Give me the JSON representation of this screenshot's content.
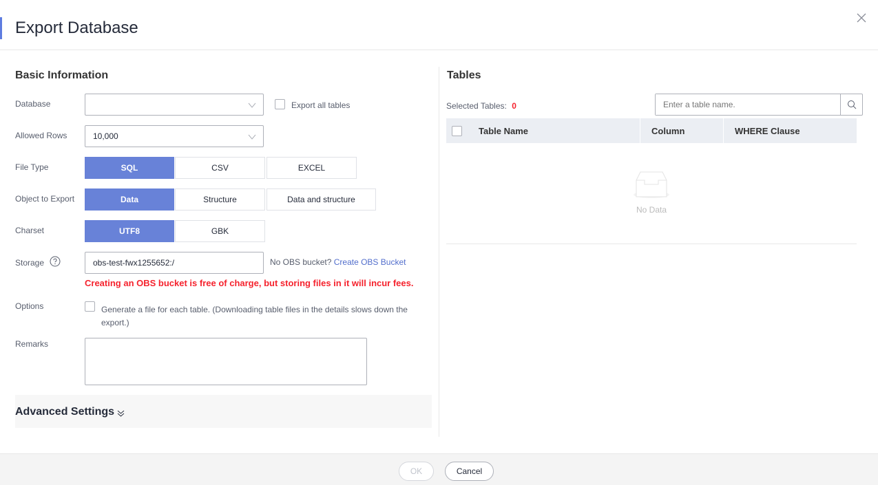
{
  "dialog": {
    "title": "Export Database"
  },
  "basic": {
    "heading": "Basic Information",
    "database": {
      "label": "Database",
      "value": "",
      "export_all": "Export all tables"
    },
    "allowed_rows": {
      "label": "Allowed Rows",
      "value": "10,000"
    },
    "file_type": {
      "label": "File Type",
      "options": [
        "SQL",
        "CSV",
        "EXCEL"
      ],
      "selected": "SQL"
    },
    "object": {
      "label": "Object to Export",
      "options": [
        "Data",
        "Structure",
        "Data and structure"
      ],
      "selected": "Data"
    },
    "charset": {
      "label": "Charset",
      "options": [
        "UTF8",
        "GBK"
      ],
      "selected": "UTF8"
    },
    "storage": {
      "label": "Storage",
      "value": "obs-test-fwx1255652:/",
      "no_bucket": "No OBS bucket?",
      "create_link": "Create OBS Bucket",
      "warning": "Creating an OBS bucket is free of charge, but storing files in it will incur fees."
    },
    "options": {
      "label": "Options",
      "text": "Generate a file for each table. (Downloading table files in the details slows down the",
      "text2": "export.)"
    },
    "remarks": {
      "label": "Remarks",
      "value": ""
    },
    "advanced": "Advanced Settings"
  },
  "tables": {
    "heading": "Tables",
    "selected_label": "Selected Tables:",
    "selected_count": "0",
    "search_placeholder": "Enter a table name.",
    "columns": [
      "Table Name",
      "Column",
      "WHERE Clause"
    ],
    "empty": "No Data"
  },
  "footer": {
    "ok": "OK",
    "cancel": "Cancel"
  },
  "colors": {
    "accent": "#6882d8",
    "warning": "#f5222d",
    "link": "#526ecc"
  }
}
